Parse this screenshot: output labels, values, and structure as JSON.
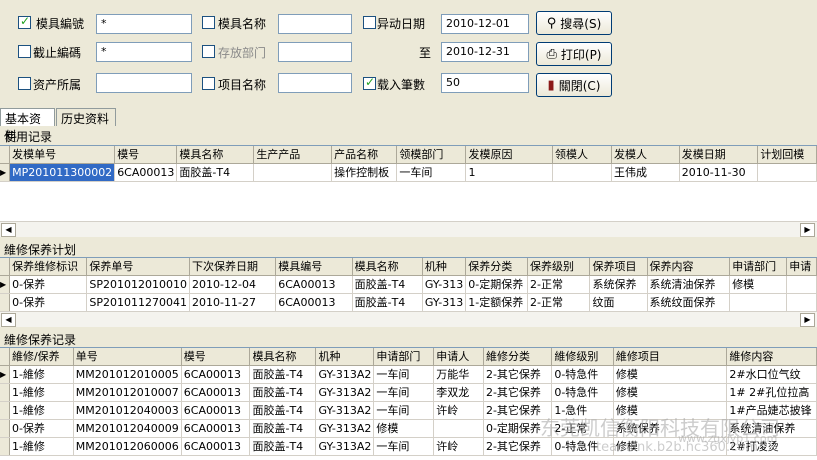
{
  "filters": {
    "mold_no": {
      "label": "模具編號",
      "checked": true,
      "value": "*"
    },
    "end_no": {
      "label": "截止編碼",
      "checked": false,
      "value": "*"
    },
    "asset_owner": {
      "label": "资产所属",
      "checked": false,
      "value": ""
    },
    "mold_name": {
      "label": "模具名称",
      "checked": false,
      "value": ""
    },
    "storage_dept": {
      "label": "存放部门",
      "checked": false,
      "value": ""
    },
    "project_name": {
      "label": "项目名称",
      "checked": false,
      "value": ""
    },
    "change_date": {
      "label": "异动日期",
      "checked": false,
      "from": "2010-12-01",
      "to_label": "至",
      "to": "2010-12-31"
    },
    "records": {
      "label": "载入筆數",
      "checked": true,
      "value": "50"
    }
  },
  "buttons": {
    "search": "搜尋(S)",
    "print": "打印(P)",
    "close": "關閉(C)"
  },
  "tabs": [
    "基本资料",
    "历史资料"
  ],
  "usage": {
    "title": "使用记录",
    "columns": [
      "发模单号",
      "模号",
      "模具名称",
      "生产产品",
      "产品名称",
      "领模部门",
      "发模原因",
      "领模人",
      "发模人",
      "发模日期",
      "计划回模"
    ],
    "rows": [
      [
        "MP201011300002",
        "6CA00013",
        "面胶盖-T4",
        "",
        "操作控制板",
        "一车间",
        "1",
        "",
        "王伟成",
        "2010-11-30",
        ""
      ]
    ]
  },
  "plan": {
    "title": "維修保养计划",
    "columns": [
      "保养维修标识",
      "保养单号",
      "下次保养日期",
      "模具编号",
      "模具名称",
      "机种",
      "保养分类",
      "保养级别",
      "保养项目",
      "保养内容",
      "申请部门",
      "申请"
    ],
    "rows": [
      [
        "0-保养",
        "SP201012010010",
        "2010-12-04",
        "6CA00013",
        "面胶盖-T4",
        "GY-313",
        "0-定期保养",
        "2-正常",
        "系统保养",
        "系统清油保养",
        "修模",
        ""
      ],
      [
        "0-保养",
        "SP201011270041",
        "2010-11-27",
        "6CA00013",
        "面胶盖-T4",
        "GY-313",
        "1-定额保养",
        "2-正常",
        "纹面",
        "系统纹面保养",
        "",
        ""
      ]
    ]
  },
  "record": {
    "title": "維修保养记录",
    "columns": [
      "維修/保养",
      "单号",
      "模号",
      "模具名称",
      "机种",
      "申请部门",
      "申请人",
      "維修分类",
      "維修级别",
      "維修项目",
      "維修内容"
    ],
    "rows": [
      [
        "1-維修",
        "MM201012010005",
        "6CA00013",
        "面胶盖-T4",
        "GY-313A2",
        "一车间",
        "万能华",
        "2-其它保养",
        "0-特急件",
        "修模",
        "2#水口位气纹"
      ],
      [
        "1-維修",
        "MM201012010007",
        "6CA00013",
        "面胶盖-T4",
        "GY-313A2",
        "一车间",
        "李双龙",
        "2-其它保养",
        "0-特急件",
        "修模",
        "1# 2#孔位拉高"
      ],
      [
        "1-維修",
        "MM201012040003",
        "6CA00013",
        "面胶盖-T4",
        "GY-313A2",
        "一车间",
        "许岭",
        "2-其它保养",
        "1-急件",
        "修模",
        "1#产品婕芯披锋"
      ],
      [
        "0-保养",
        "MM201012040009",
        "6CA00013",
        "面胶盖-T4",
        "GY-313A2",
        "修模",
        "",
        "0-定期保养",
        "2-正常",
        "系统保养",
        "系统清油保养"
      ],
      [
        "1-維修",
        "MM201012060006",
        "6CA00013",
        "面胶盖-T4",
        "GY-313A2",
        "一车间",
        "许岭",
        "2-其它保养",
        "0-特急件",
        "修模",
        "2#打凌烫"
      ]
    ]
  },
  "watermark": {
    "line1": "东莞凯信衡阳科技有限公司",
    "line2": "www.zgxjyp1.com",
    "line3": "teamlink.b2b.hc360.com"
  }
}
